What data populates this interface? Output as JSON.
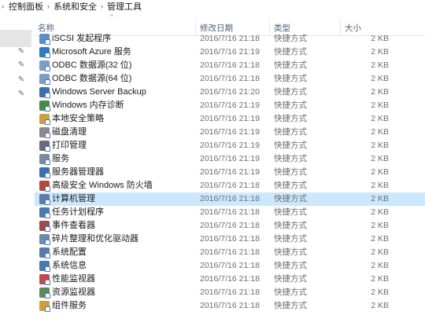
{
  "breadcrumb": {
    "items": [
      "控制面板",
      "系统和安全",
      "管理工具"
    ]
  },
  "columns": {
    "name": "名称",
    "date": "修改日期",
    "type": "类型",
    "size": "大小"
  },
  "files": [
    {
      "name": "iSCSI 发起程序",
      "date": "2016/7/16 21:18",
      "type": "快捷方式",
      "size": "2 KB",
      "icon": "iscsi-icon",
      "color": "#5b8fc9"
    },
    {
      "name": "Microsoft Azure 服务",
      "date": "2016/7/16 21:19",
      "type": "快捷方式",
      "size": "2 KB",
      "icon": "azure-icon",
      "color": "#2e7bc4"
    },
    {
      "name": "ODBC 数据源(32 位)",
      "date": "2016/7/16 21:18",
      "type": "快捷方式",
      "size": "2 KB",
      "icon": "odbc-icon",
      "color": "#7a9ec4"
    },
    {
      "name": "ODBC 数据源(64 位)",
      "date": "2016/7/16 21:18",
      "type": "快捷方式",
      "size": "2 KB",
      "icon": "odbc-icon",
      "color": "#7a9ec4"
    },
    {
      "name": "Windows Server Backup",
      "date": "2016/7/16 21:20",
      "type": "快捷方式",
      "size": "2 KB",
      "icon": "backup-icon",
      "color": "#3a6fb0"
    },
    {
      "name": "Windows 内存诊断",
      "date": "2016/7/16 21:19",
      "type": "快捷方式",
      "size": "2 KB",
      "icon": "memory-icon",
      "color": "#4a8a4a"
    },
    {
      "name": "本地安全策略",
      "date": "2016/7/16 21:19",
      "type": "快捷方式",
      "size": "2 KB",
      "icon": "security-policy-icon",
      "color": "#c9a03a"
    },
    {
      "name": "磁盘清理",
      "date": "2016/7/16 21:19",
      "type": "快捷方式",
      "size": "2 KB",
      "icon": "disk-cleanup-icon",
      "color": "#8a8a8a"
    },
    {
      "name": "打印管理",
      "date": "2016/7/16 21:19",
      "type": "快捷方式",
      "size": "2 KB",
      "icon": "printer-icon",
      "color": "#6a6a7a"
    },
    {
      "name": "服务",
      "date": "2016/7/16 21:19",
      "type": "快捷方式",
      "size": "2 KB",
      "icon": "services-icon",
      "color": "#7a8aa0"
    },
    {
      "name": "服务器管理器",
      "date": "2016/7/16 21:19",
      "type": "快捷方式",
      "size": "2 KB",
      "icon": "server-manager-icon",
      "color": "#3a6fb0"
    },
    {
      "name": "高级安全 Windows 防火墙",
      "date": "2016/7/16 21:18",
      "type": "快捷方式",
      "size": "2 KB",
      "icon": "firewall-icon",
      "color": "#b04a3a"
    },
    {
      "name": "计算机管理",
      "date": "2016/7/16 21:18",
      "type": "快捷方式",
      "size": "2 KB",
      "icon": "computer-management-icon",
      "color": "#5a7ab0"
    },
    {
      "name": "任务计划程序",
      "date": "2016/7/16 21:18",
      "type": "快捷方式",
      "size": "2 KB",
      "icon": "task-scheduler-icon",
      "color": "#4a7ab0"
    },
    {
      "name": "事件查看器",
      "date": "2016/7/16 21:18",
      "type": "快捷方式",
      "size": "2 KB",
      "icon": "event-viewer-icon",
      "color": "#a04a4a"
    },
    {
      "name": "碎片整理和优化驱动器",
      "date": "2016/7/16 21:18",
      "type": "快捷方式",
      "size": "2 KB",
      "icon": "defrag-icon",
      "color": "#6a8ab0"
    },
    {
      "name": "系统配置",
      "date": "2016/7/16 21:18",
      "type": "快捷方式",
      "size": "2 KB",
      "icon": "system-config-icon",
      "color": "#5a7ab0"
    },
    {
      "name": "系统信息",
      "date": "2016/7/16 21:18",
      "type": "快捷方式",
      "size": "2 KB",
      "icon": "system-info-icon",
      "color": "#4a7ab0"
    },
    {
      "name": "性能监视器",
      "date": "2016/7/16 21:18",
      "type": "快捷方式",
      "size": "2 KB",
      "icon": "performance-monitor-icon",
      "color": "#c04a4a"
    },
    {
      "name": "资源监视器",
      "date": "2016/7/16 21:18",
      "type": "快捷方式",
      "size": "2 KB",
      "icon": "resource-monitor-icon",
      "color": "#5a8a5a"
    },
    {
      "name": "组件服务",
      "date": "2016/7/16 21:18",
      "type": "快捷方式",
      "size": "2 KB",
      "icon": "component-services-icon",
      "color": "#c9a03a"
    }
  ],
  "selected_index": 12,
  "colors": {
    "selection": "#cce8ff",
    "header_text": "#4c607a"
  }
}
